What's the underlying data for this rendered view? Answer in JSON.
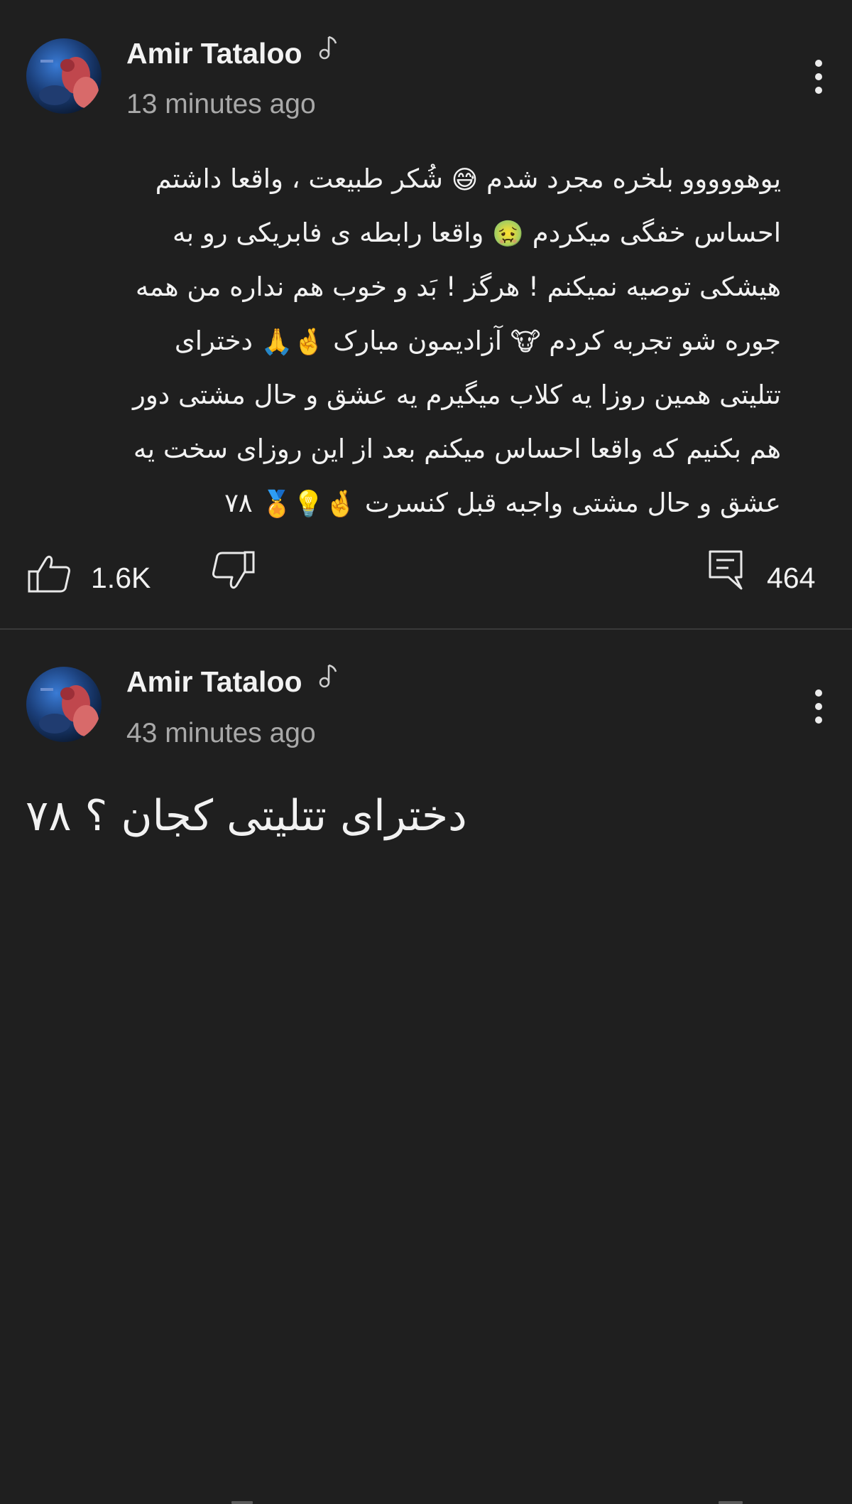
{
  "comments": [
    {
      "author": "Amir Tataloo",
      "time": "13 minutes ago",
      "avatar_icon": "profile-photo",
      "badge_icon": "music-note-icon",
      "lines": [
        {
          "text": "یوهووووو بلخره مجرد شدم",
          "emoji": "😅",
          "text_after": "شُکر طبیعت ، واقعا داشتم"
        },
        {
          "text": "احساس خفگی میکردم",
          "emoji": "🤢",
          "text_after": "واقعا رابطه ی فابریکی رو به"
        },
        {
          "text": "هیشکی توصیه نمیکنم ! هرگز ! بَد و خوب هم نداره من همه"
        },
        {
          "text": "جوره شو تجربه کردم",
          "emoji": "🐮",
          "text_after": "آزادیمون مبارک",
          "emoji2": "🤞🙏",
          "text_end": "دخترای"
        },
        {
          "text": "تتلیتی همین روزا یه کلاب میگیرم یه عشق و حال مشتی دور"
        },
        {
          "text": "هم بکنیم که واقعا احساس میکنم بعد از این روزای سخت یه"
        },
        {
          "text": "عشق و حال مشتی واجبه قبل کنسرت",
          "emoji": "🤞💡🏅",
          "text_after": "۷۸"
        }
      ],
      "likes": "1.6K",
      "replies": "464"
    },
    {
      "author": "Amir Tataloo",
      "time": "43 minutes ago",
      "avatar_icon": "profile-photo",
      "badge_icon": "music-note-icon",
      "text": "دخترای تتلیتی کجان ؟ ۷۸"
    }
  ],
  "colors": {
    "background": "#1f1f1f",
    "text": "#f2f2f2",
    "secondary_text": "#a9a9a9",
    "divider": "#3a3a3a"
  }
}
